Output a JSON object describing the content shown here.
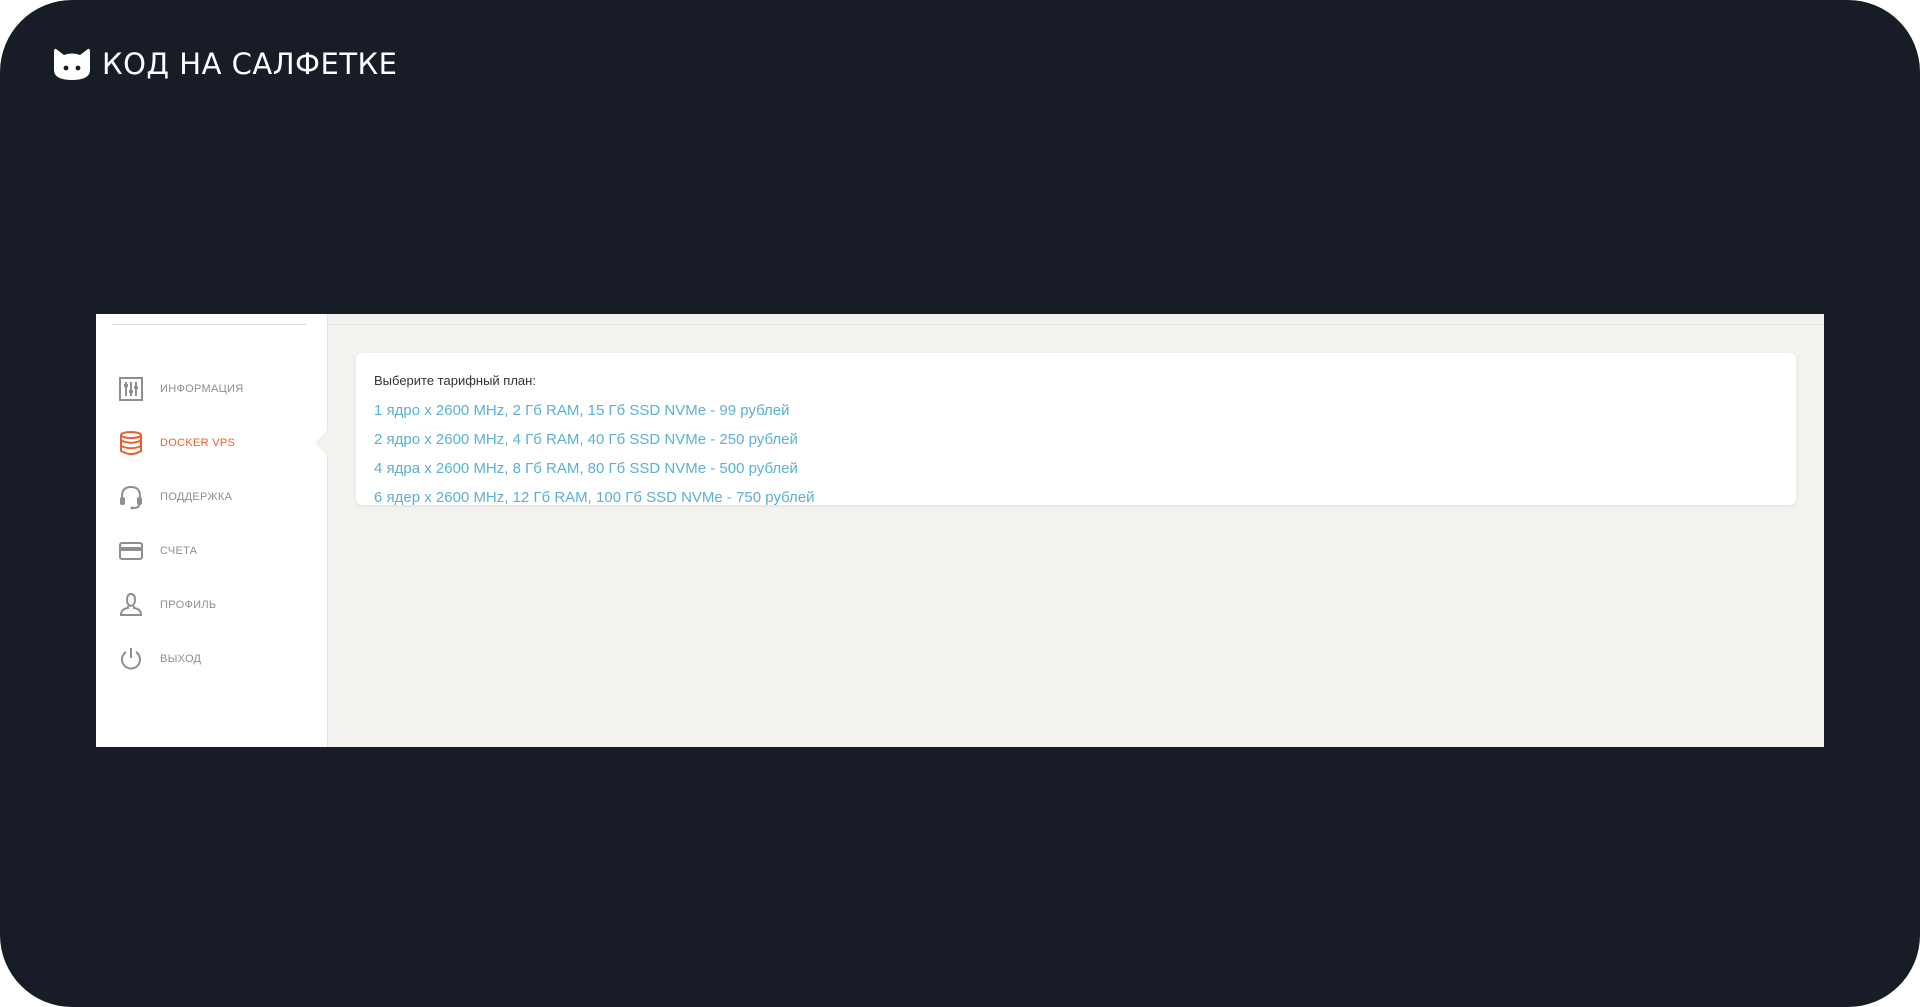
{
  "brand": {
    "name": "КОД НА САЛФЕТКЕ"
  },
  "sidebar": {
    "items": [
      {
        "label": "ИНФОРМАЦИЯ",
        "icon": "sliders-icon",
        "active": false
      },
      {
        "label": "DOCKER VPS",
        "icon": "database-icon",
        "active": true
      },
      {
        "label": "ПОДДЕРЖКА",
        "icon": "headset-icon",
        "active": false
      },
      {
        "label": "СЧЕТА",
        "icon": "credit-card-icon",
        "active": false
      },
      {
        "label": "ПРОФИЛЬ",
        "icon": "user-icon",
        "active": false
      },
      {
        "label": "ВЫХОД",
        "icon": "power-icon",
        "active": false
      }
    ]
  },
  "main": {
    "prompt": "Выберите тарифный план:",
    "plans": [
      "1 ядро x 2600 MHz, 2 Гб RAM, 15 Гб SSD NVMe - 99 рублей",
      "2 ядро x 2600 MHz, 4 Гб RAM, 40 Гб SSD NVMe - 250 рублей",
      "4 ядра x 2600 MHz, 8 Гб RAM, 80 Гб SSD NVMe - 500 рублей",
      "6 ядер x 2600 MHz, 12 Гб RAM, 100 Гб SSD NVMe - 750 рублей"
    ]
  },
  "colors": {
    "background": "#181c26",
    "accent": "#e8612d",
    "link": "#5ab1d1",
    "icon": "#8f8f8f",
    "panel": "#f3f2ee"
  }
}
